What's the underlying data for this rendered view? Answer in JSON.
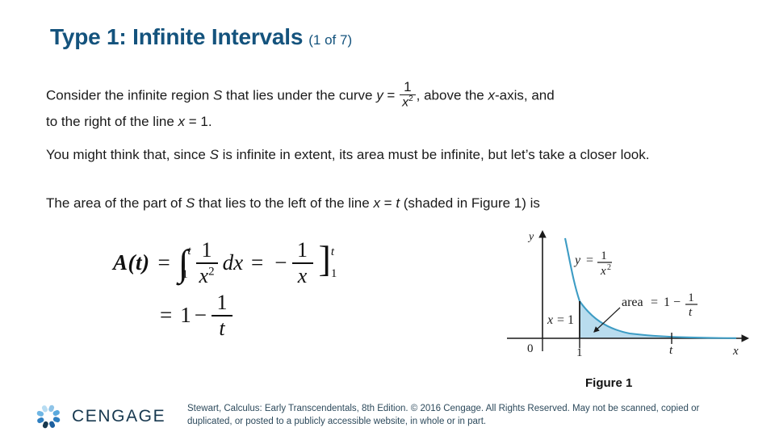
{
  "slide": {
    "title_main": "Type 1: Infinite Intervals",
    "title_sub": "(1 of 7)",
    "title_color": "#14537d"
  },
  "body": {
    "para1": {
      "before_fraction": "Consider the infinite region S that lies under the curve y = ",
      "lead": "Consider the infinite region ",
      "var_s": "S",
      "mid": " that lies under the curve ",
      "var_y": "y",
      "equals": " = ",
      "frac_num": "1",
      "frac_den": "x",
      "frac_den_exp": "2",
      "after_fraction": ", above the ",
      "var_x": "x",
      "after_x": "-axis, and",
      "line2_a": "to the right of the line ",
      "line2_x": "x",
      "line2_b": " = 1."
    },
    "para2": {
      "a": "You might think that, since ",
      "var_s": "S",
      "b": " is infinite in extent, its area must be infinite, but let’s take a closer look."
    },
    "para3": {
      "a": "The area of the part of ",
      "var_s": "S",
      "b": " that lies to the left of the line ",
      "var_x": "x",
      "c": " = ",
      "var_t": "t",
      "d": " (shaded in Figure 1) is"
    }
  },
  "equation": {
    "lhs": "A(t)",
    "equals": "=",
    "integral_glyph": "∫",
    "integral_upper": "t",
    "integral_lower": "1",
    "frac1_num": "1",
    "frac1_den": "x",
    "frac1_den_exp": "2",
    "dx": "dx",
    "equals2": "=",
    "minus": "−",
    "frac2_num": "1",
    "frac2_den": "x",
    "bracket": "]",
    "bracket_upper": "t",
    "bracket_lower": "1",
    "line2_equals": "=",
    "line2_one": "1",
    "line2_minus": "−",
    "line2_frac_num": "1",
    "line2_frac_den": "t"
  },
  "figure": {
    "caption": "Figure 1",
    "axis_y_label": "y",
    "axis_x_label": "x",
    "origin_label": "0",
    "tick_one_label": "1",
    "tick_t_label": "t",
    "curve_label_y": "y",
    "curve_label_eq": "=",
    "curve_label_num": "1",
    "curve_label_den": "x",
    "curve_label_den_exp": "2",
    "vline_label_x": "x",
    "vline_label_eq": "= 1",
    "area_label_word": "area",
    "area_label_eq": "=",
    "area_label_one": "1",
    "area_label_minus": "−",
    "area_label_num": "1",
    "area_label_den": "t",
    "curve_color": "#3d9cc4",
    "shade_color": "#b9dcee",
    "axis_color": "#1a1a1a"
  },
  "footer": {
    "logo_word": "CENGAGE",
    "logo_color": "#17384f",
    "note_line1": "Stewart, Calculus: Early Transcendentals, 8th Edition. © 2016 Cengage. All Rights Reserved. May not be",
    "note_line2": "scanned, copied or duplicated, or posted to a publicly accessible website, in whole or in part.",
    "note_color": "#2d4a5c"
  }
}
